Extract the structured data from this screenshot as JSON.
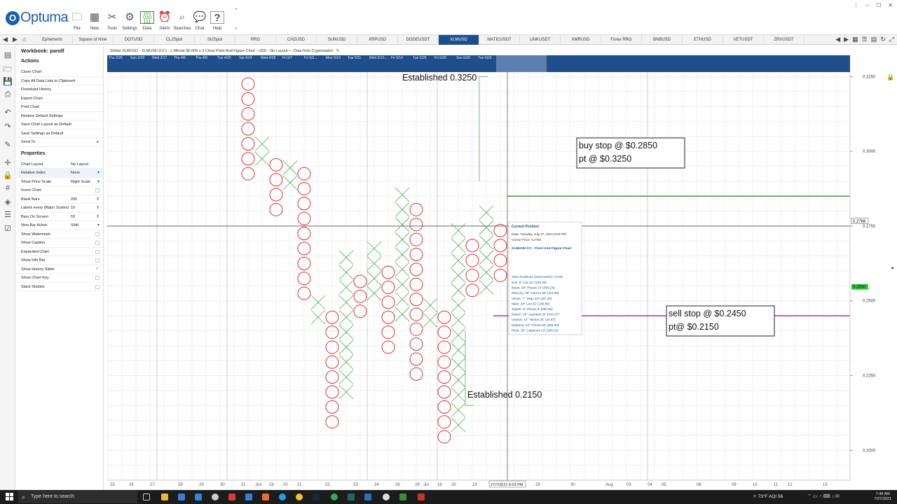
{
  "app": {
    "logo_text": "Optuma",
    "ribbon": [
      "File",
      "New",
      "Tools",
      "Settings",
      "Data",
      "Alerts",
      "Searches",
      "Chat",
      "Help"
    ],
    "window_controls": [
      "–",
      "☐",
      "✕"
    ]
  },
  "tabs": {
    "items": [
      "Ephemeris",
      "Square of Nine",
      "DOTUSD",
      "CL2Spot",
      "SI2Spot",
      "RRG",
      "CHZUSD",
      "SUNUSD",
      "XRPUSD",
      "DOGEUSDT",
      "XLMUSD",
      "MATICUSDT",
      "LINKUSDT",
      "XMRUSD",
      "Forex RRG",
      "BNBUSD",
      "ETHUSD",
      "VETUSDT",
      "ZRXUSDT"
    ],
    "active_index": 10
  },
  "panel": {
    "workbook": "Workbook: pandf",
    "actions_title": "Actions",
    "actions": [
      "Clone Chart",
      "Copy All Data Lists to Clipboard",
      "Download History",
      "Export Chart",
      "Print Chart",
      "Restore Default Settings",
      "Save Chart Layout as Default",
      "Save Settings as Default",
      "Send To"
    ],
    "properties_title": "Properties",
    "properties": [
      {
        "k": "Chart Layout",
        "v": "No Layout",
        "ctl": ""
      },
      {
        "k": "Relative Index",
        "v": "None",
        "ctl": "▾"
      },
      {
        "k": "Show Price Scale",
        "v": "Right Scale",
        "ctl": "▾"
      },
      {
        "k": "Invert Chart",
        "v": "",
        "ctl": "check"
      },
      {
        "k": "Blank Bars",
        "v": "200",
        "ctl": "⇕"
      },
      {
        "k": "Labels every (Major Scales)",
        "v": "10",
        "ctl": "⇕"
      },
      {
        "k": "Bars On Screen",
        "v": "53",
        "ctl": "⇕"
      },
      {
        "k": "New Bar Action",
        "v": "Shift",
        "ctl": "▾"
      },
      {
        "k": "Show Watermark",
        "v": "",
        "ctl": "check"
      },
      {
        "k": "Show Caption",
        "v": "",
        "ctl": "check"
      },
      {
        "k": "Expanded Chart",
        "v": "",
        "ctl": "check"
      },
      {
        "k": "Show Info Bar",
        "v": "",
        "ctl": "check"
      },
      {
        "k": "Show History Slider",
        "v": "",
        "ctl": "checked"
      },
      {
        "k": "Show Chart Key",
        "v": "",
        "ctl": "check"
      },
      {
        "k": "Stack Studies",
        "v": "",
        "ctl": "check"
      }
    ]
  },
  "chart": {
    "header": "Stellar XLMUSD - XLMUSD (CC) - 1 Minute $0.005 x 3 Close Point And Figure Chart - USD - No Layout — Data from Cryptowatch",
    "history_labels": [
      "Thu 2/25",
      "Sun 2/28",
      "Wed 3/17",
      "Thu 4/6",
      "Thu 4/8",
      "Tue 4/20",
      "Sat 4/24",
      "Wed 4/28",
      "Fri 5/7",
      "Fri 5/2...",
      "Mon 5/10",
      "Tue 5/11",
      "Wed 5/12...",
      "Fri 5/14",
      "Tue 5/25",
      "Fri 5/28",
      "Sun 6/20",
      "Tue 6/29"
    ],
    "price_ticks": [
      "0.3250",
      "0.3000",
      "0.2750",
      "0.2500",
      "0.2250",
      "0.2000"
    ],
    "price_flag_cursor": "0.2766",
    "price_flag_current": "0.2500",
    "date_labels": [
      "25",
      "26",
      "27",
      "28",
      "29",
      "30",
      "31",
      "Jun",
      "19",
      "20",
      "21",
      "22",
      "23",
      "24",
      "26",
      "29",
      "Jul",
      "16",
      "20",
      "23",
      "27/7/2021  8:03 PM",
      "29",
      "30",
      "Aug",
      "03",
      "04",
      "05",
      "06",
      "09",
      "10",
      "11",
      "12",
      "13"
    ],
    "annotations": {
      "established_top": "Established 0.3250",
      "established_bottom": "Established 0.2150",
      "buy_line1": "buy stop @ $0.2850",
      "buy_line2": "pt @ $0.3250",
      "sell_line1": "sell stop @ $0.2450",
      "sell_line2": "pt@ $0.2150"
    },
    "tooltip": {
      "title": "Current Position",
      "date": "Date: Tuesday, July 27, 2021 8:03 PM",
      "cursor": "Cursor Price: 0.2750",
      "chart": "XLMUSD:CC - Point And Figure Chart",
      "astro_title": "Astro Positions (GeoCentric) (-5:00)",
      "astro": [
        "Sun: 5° Leo 12' (125.20)",
        "Moon: 25° Pisces 14' (355.24)",
        "Mercury: 29° Cancer 59' (119.99)",
        "Venus: 7° Virgo 13' (157.22)",
        "Mars: 28° Leo 52' (148.86)",
        "Jupiter: 0° Pisces 3' (330.05)",
        "Saturn: 10° Aquarius 34' (310.57)",
        "Uranus: 14° Taurus 34' (44.57)",
        "Neptune: 22° Pisces 56' (352.93)",
        "Pluto: 25° Capricorn 19' (295.32)"
      ]
    }
  },
  "chart_data": {
    "type": "point-and-figure",
    "title": "Stellar XLMUSD - XLMUSD (CC) - 1 Minute $0.005 x 3 Close Point And Figure Chart - USD - No Layout — Data from Cryptowatch",
    "box_size": 0.005,
    "y_range": [
      0.19,
      0.3265
    ],
    "y_ticks": [
      0.325,
      0.3,
      0.275,
      0.25,
      0.225,
      0.2
    ],
    "grid": true,
    "columns": [
      {
        "type": "O",
        "high": 0.325,
        "low": 0.29
      },
      {
        "type": "X",
        "high": 0.305,
        "low": 0.295
      },
      {
        "type": "O",
        "high": 0.299,
        "low": 0.278
      },
      {
        "type": "X",
        "high": 0.299,
        "low": 0.287
      },
      {
        "type": "O",
        "high": 0.294,
        "low": 0.25
      },
      {
        "type": "X",
        "high": 0.25,
        "low": 0.242
      },
      {
        "type": "O",
        "high": 0.249,
        "low": 0.207
      },
      {
        "type": "X",
        "high": 0.265,
        "low": 0.217
      },
      {
        "type": "O",
        "high": 0.259,
        "low": 0.244
      },
      {
        "type": "X",
        "high": 0.27,
        "low": 0.25
      },
      {
        "type": "O",
        "high": 0.264,
        "low": 0.232
      },
      {
        "type": "X",
        "high": 0.29,
        "low": 0.243
      },
      {
        "type": "O",
        "high": 0.283,
        "low": 0.223
      },
      {
        "type": "X",
        "high": 0.25,
        "low": 0.241
      },
      {
        "type": "O",
        "high": 0.249,
        "low": 0.202
      },
      {
        "type": "X",
        "high": 0.275,
        "low": 0.206
      },
      {
        "type": "O",
        "high": 0.269,
        "low": 0.251
      },
      {
        "type": "X",
        "high": 0.28,
        "low": 0.252
      },
      {
        "type": "O",
        "high": 0.274,
        "low": 0.256
      }
    ],
    "levels": [
      {
        "name": "buy stop",
        "price": 0.285,
        "color": "#2a7a2a"
      },
      {
        "name": "cursor",
        "price": 0.275,
        "color": "#555555"
      },
      {
        "name": "sell stop",
        "price": 0.245,
        "color": "#a0185a"
      }
    ],
    "established": [
      0.325,
      0.215
    ]
  }
}
